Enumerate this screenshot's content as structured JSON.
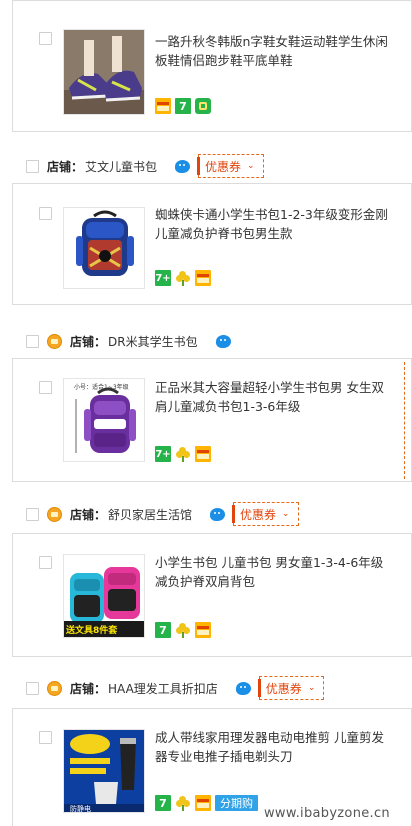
{
  "items": [
    {
      "title": "一路升秋冬韩版n字鞋女鞋运动鞋学生休闲板鞋情侣跑步鞋平底单鞋",
      "icons": [
        "credit-card-icon",
        "tmall-7-day-return-icon",
        "robot-service-icon"
      ]
    },
    {
      "title": "蜘蛛侠卡通小学生书包1-2-3年级变形金刚儿童减负护脊书包男生款",
      "icons": [
        "tmall-7plus-icon",
        "flower-icon",
        "credit-card-icon"
      ]
    },
    {
      "title": "正品米其大容量超轻小学生书包男 女生双肩儿童减负书包1-3-6年级",
      "thumb_text": "小号：适合1~3年级",
      "icons": [
        "tmall-7plus-icon",
        "flower-icon",
        "credit-card-icon"
      ]
    },
    {
      "title": "小学生书包 儿童书包 男女童1-3-4-6年级减负护脊双肩背包",
      "thumb_text": "送文具8件套",
      "icons": [
        "tmall-7-day-return-icon",
        "flower-icon",
        "credit-card-icon"
      ]
    },
    {
      "title": "成人带线家用理发器电动电推剪 儿童剪发器专业电推子插电剃头刀",
      "thumb_text": "防静电",
      "icons": [
        "tmall-7-day-return-icon",
        "flower-icon",
        "credit-card-icon"
      ],
      "fenqi": "分期购"
    }
  ],
  "shops": [
    {
      "label": "店铺：",
      "name": "艾文儿童书包",
      "coupon": "优惠券"
    },
    {
      "label": "店铺：",
      "name": "DR米其学生书包"
    },
    {
      "label": "店铺：",
      "name": "舒贝家居生活馆",
      "coupon": "优惠券"
    },
    {
      "label": "店铺：",
      "name": "HAA理发工具折扣店",
      "coupon": "优惠券"
    }
  ],
  "watermark": "www.ibabyzone.cn",
  "colors": {
    "coupon": "#e2450c",
    "tmall_green": "#26b34a",
    "wangwang_blue": "#1b8ee6",
    "fenqi_blue": "#2fa2e8"
  }
}
